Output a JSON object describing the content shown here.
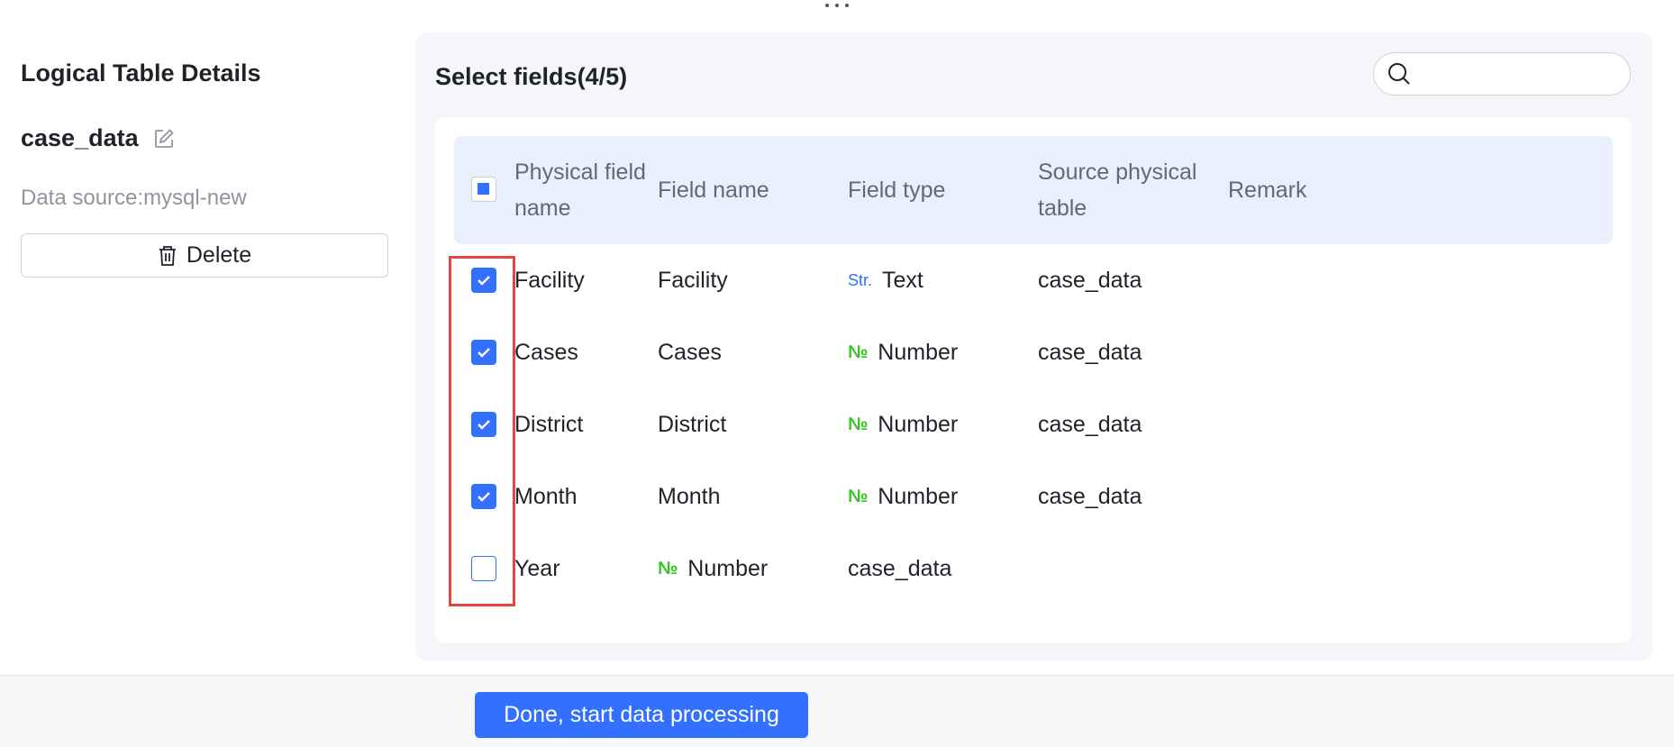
{
  "left_panel": {
    "title": "Logical Table Details",
    "table_name": "case_data",
    "data_source": "Data source:mysql-new",
    "delete_label": "Delete"
  },
  "right_panel": {
    "title": "Select fields(4/5)",
    "search_placeholder": "",
    "headers": {
      "physical_field_name": [
        "Physical field",
        "name"
      ],
      "field_name": "Field name",
      "field_type": "Field type",
      "source_physical_table": [
        "Source physical",
        "table"
      ],
      "remark": "Remark"
    },
    "rows": [
      {
        "checked": true,
        "physical": "Facility",
        "field_name": "Facility",
        "type_icon": "Str.",
        "type": "Text",
        "source": "case_data"
      },
      {
        "checked": true,
        "physical": "Cases",
        "field_name": "Cases",
        "type_icon": "№",
        "type": "Number",
        "source": "case_data"
      },
      {
        "checked": true,
        "physical": "District",
        "field_name": "District",
        "type_icon": "№",
        "type": "Number",
        "source": "case_data"
      },
      {
        "checked": true,
        "physical": "Month",
        "field_name": "Month",
        "type_icon": "№",
        "type": "Number",
        "source": "case_data"
      },
      {
        "checked": false,
        "physical": "Year",
        "type_icon": "№",
        "type": "Number",
        "source": "case_data"
      }
    ]
  },
  "footer": {
    "done_label": "Done, start data processing"
  },
  "colors": {
    "accent": "#3370ff",
    "number_icon": "#34c724",
    "highlight": "#e5473f",
    "header_bg": "#e9effd"
  }
}
